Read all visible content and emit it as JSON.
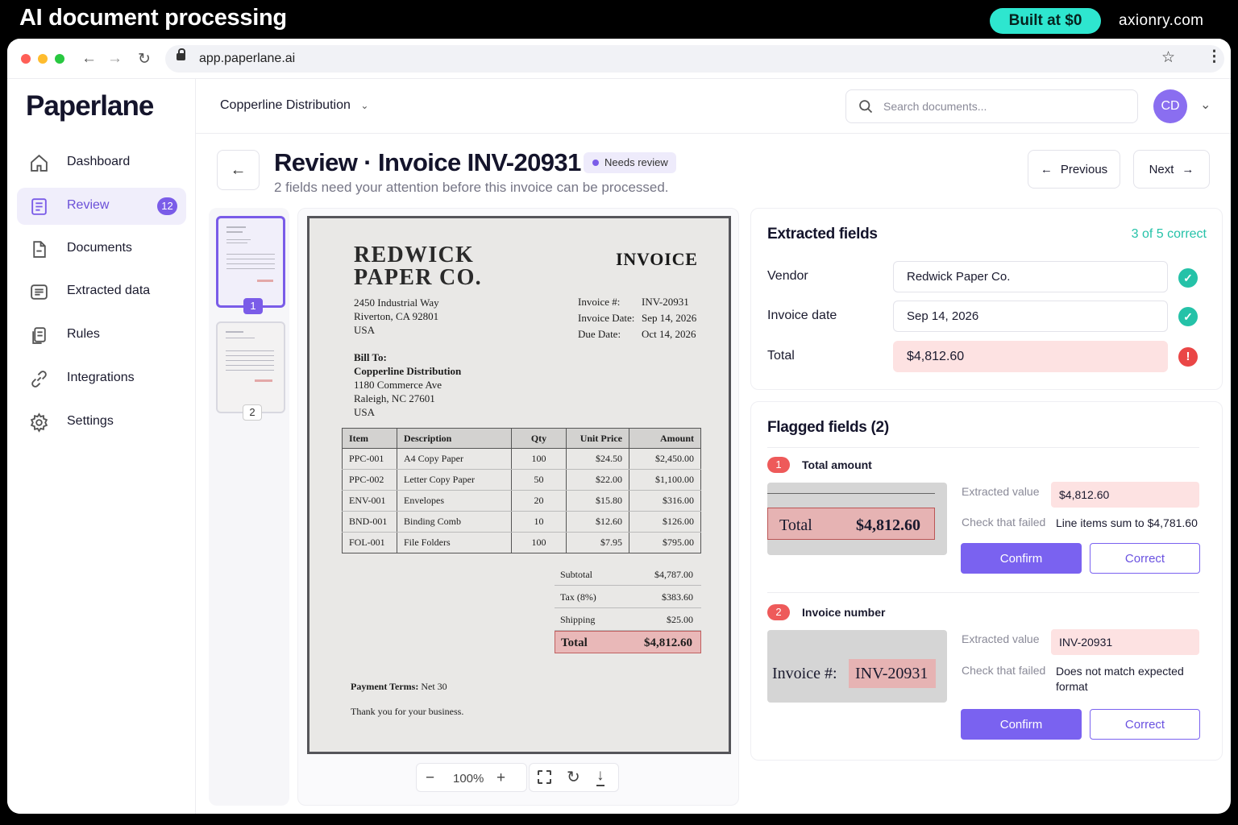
{
  "banner": {
    "title": "AI document processing",
    "pill": "Built at $0",
    "domain": "axionry.com",
    "pill_color": "#2ee6cf"
  },
  "browser": {
    "url": "app.paperlane.ai"
  },
  "app": {
    "logo": "Paperlane",
    "accent": "#7a5ce8"
  },
  "sidebar": {
    "items": [
      {
        "label": "Dashboard",
        "icon": "home-icon"
      },
      {
        "label": "Review",
        "icon": "review-icon",
        "badge": "12",
        "active": true
      },
      {
        "label": "Documents",
        "icon": "document-icon"
      },
      {
        "label": "Extracted data",
        "icon": "extracted-data-icon"
      },
      {
        "label": "Rules",
        "icon": "rules-icon"
      },
      {
        "label": "Integrations",
        "icon": "link-icon"
      },
      {
        "label": "Settings",
        "icon": "gear-icon"
      }
    ]
  },
  "topbar": {
    "org": "Copperline Distribution",
    "search_placeholder": "Search documents...",
    "avatar": "CD"
  },
  "header": {
    "title": "Review · Invoice INV-20931",
    "status": "Needs review",
    "subtitle": "2 fields need your attention before this invoice can be processed.",
    "prev": "Previous",
    "next": "Next"
  },
  "pages": {
    "numbers": [
      "1",
      "2"
    ]
  },
  "invoice": {
    "vendor_line1": "REDWICK",
    "vendor_line2": "PAPER CO.",
    "title": "INVOICE",
    "addr": [
      "2450 Industrial Way",
      "Riverton, CA 92801",
      "USA"
    ],
    "meta": [
      {
        "k": "Invoice #:",
        "v": "INV-20931"
      },
      {
        "k": "Invoice Date:",
        "v": "Sep 14, 2026"
      },
      {
        "k": "Due Date:",
        "v": "Oct 14, 2026"
      }
    ],
    "bill_label": "Bill To:",
    "bill": [
      "Copperline Distribution",
      "1180 Commerce Ave",
      "Raleigh, NC 27601",
      "USA"
    ],
    "columns": [
      "Item",
      "Description",
      "Qty",
      "Unit Price",
      "Amount"
    ],
    "rows": [
      [
        "PPC-001",
        "A4 Copy Paper",
        "100",
        "$24.50",
        "$2,450.00"
      ],
      [
        "PPC-002",
        "Letter Copy Paper",
        "50",
        "$22.00",
        "$1,100.00"
      ],
      [
        "ENV-001",
        "Envelopes",
        "20",
        "$15.80",
        "$316.00"
      ],
      [
        "BND-001",
        "Binding Comb",
        "10",
        "$12.60",
        "$126.00"
      ],
      [
        "FOL-001",
        "File Folders",
        "100",
        "$7.95",
        "$795.00"
      ]
    ],
    "totals": [
      {
        "label": "Subtotal",
        "value": "$4,787.00"
      },
      {
        "label": "Tax (8%)",
        "value": "$383.60"
      },
      {
        "label": "Shipping",
        "value": "$25.00"
      },
      {
        "label": "Total",
        "value": "$4,812.60"
      }
    ],
    "terms_label": "Payment Terms:",
    "terms_value": "Net 30",
    "thanks": "Thank you for your business."
  },
  "zoom": {
    "level": "100%"
  },
  "extracted": {
    "title": "Extracted fields",
    "summary": "3 of 5 correct",
    "fields": [
      {
        "label": "Vendor",
        "value": "Redwick Paper Co.",
        "status": "ok"
      },
      {
        "label": "Invoice date",
        "value": "Sep 14, 2026",
        "status": "ok"
      },
      {
        "label": "Total",
        "value": "$4,812.60",
        "status": "error"
      }
    ],
    "ok_color": "#25c2a8",
    "error_color": "#ea4646"
  },
  "flagged": {
    "title": "Flagged fields (2)",
    "extracted_label": "Extracted value",
    "check_label": "Check that failed",
    "confirm": "Confirm",
    "correct": "Correct",
    "items": [
      {
        "num": "1",
        "name": "Total amount",
        "crop_label": "Total",
        "crop_value": "$4,812.60",
        "value": "$4,812.60",
        "check": "Line items sum to $4,781.60"
      },
      {
        "num": "2",
        "name": "Invoice number",
        "crop_label": "Invoice #:",
        "crop_value": "INV-20931",
        "value": "INV-20931",
        "check": "Does not match expected format"
      }
    ]
  }
}
